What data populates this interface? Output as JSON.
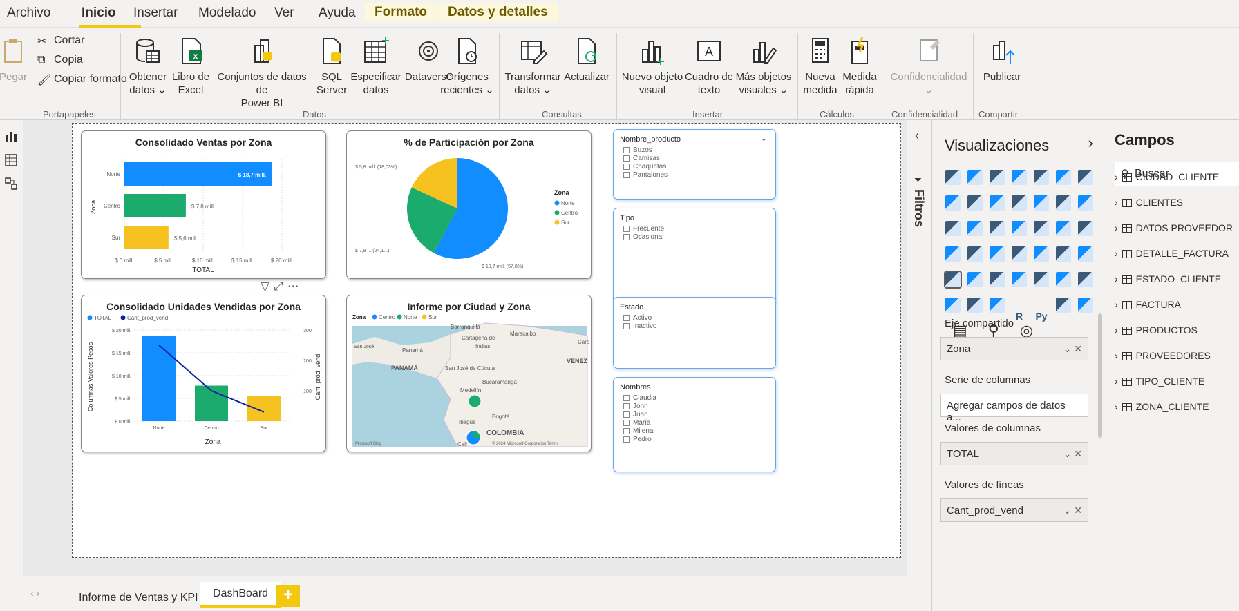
{
  "ribbon_tabs": {
    "archivo": "Archivo",
    "inicio": "Inicio",
    "insertar": "Insertar",
    "modelado": "Modelado",
    "ver": "Ver",
    "ayuda": "Ayuda",
    "formato": "Formato",
    "datos_detalles": "Datos y detalles"
  },
  "ribbon": {
    "pegar": "Pegar",
    "cortar": "Cortar",
    "copia": "Copia",
    "copiar_formato": "Copiar formato",
    "portapapeles": "Portapapeles",
    "obtener_datos": [
      "Obtener",
      "datos ⌄"
    ],
    "libro_excel": [
      "Libro de",
      "Excel"
    ],
    "conjuntos": [
      "Conjuntos de datos de",
      "Power BI"
    ],
    "sql": [
      "SQL",
      "Server"
    ],
    "especificar": [
      "Especificar",
      "datos"
    ],
    "dataverse": [
      "Dataverse",
      ""
    ],
    "origenes": [
      "Orígenes",
      "recientes ⌄"
    ],
    "datos_group": "Datos",
    "transformar": [
      "Transformar",
      "datos ⌄"
    ],
    "actualizar": [
      "Actualizar",
      ""
    ],
    "consultas_group": "Consultas",
    "nuevo_objeto": [
      "Nuevo objeto",
      "visual"
    ],
    "cuadro_texto": [
      "Cuadro de",
      "texto"
    ],
    "mas_objetos": [
      "Más objetos",
      "visuales ⌄"
    ],
    "insertar_group": "Insertar",
    "nueva_medida": [
      "Nueva",
      "medida"
    ],
    "medida_rapida": [
      "Medida",
      "rápida"
    ],
    "calculos_group": "Cálculos",
    "confidencialidad": "Confidencialidad",
    "confidencialidad_group": "Confidencialidad",
    "publicar": "Publicar",
    "compartir_group": "Compartir"
  },
  "colors": {
    "accent": "#f2c811",
    "norte": "#118dff",
    "centro": "#1aab6d",
    "sur": "#f5c220",
    "line": "#12239e"
  },
  "visual1": {
    "title": "Consolidado Ventas por Zona",
    "xlabel": "TOTAL",
    "ylabel": "Zona"
  },
  "visual2": {
    "title": "% de Participación por Zona",
    "legend_title": "Zona",
    "legend": [
      "Norte",
      "Centro",
      "Sur"
    ]
  },
  "visual3": {
    "title": "Consolidado Unidades Vendidas por Zona",
    "legend": [
      "TOTAL",
      "Cant_prod_vend"
    ],
    "xlabel": "Zona",
    "ylabel_left": "Columnas Valores Pesos",
    "ylabel_right": "Cant_prod_vend"
  },
  "visual4": {
    "title": "Informe por Ciudad y Zona",
    "legend_title": "Zona",
    "legend": [
      "Centro",
      "Norte",
      "Sur"
    ],
    "places": [
      "Barranquilla",
      "Maracaibo",
      "Cartagena de",
      "Indias",
      "San José",
      "Panamá",
      "PANAMÁ",
      "San José de Cúcuta",
      "VENEZ",
      "Bucaramanga",
      "Medellín",
      "Bogotá",
      "Ibagué",
      "COLOMBIA",
      "Cali",
      "Cara"
    ],
    "bing": "Microsoft Bing",
    "copyright": "© 2024 Microsoft Corporation  Terms"
  },
  "chart_data": [
    {
      "type": "bar",
      "title": "Consolidado Ventas por Zona",
      "orientation": "horizontal",
      "categories": [
        "Norte",
        "Centro",
        "Sur"
      ],
      "values": [
        18.7,
        7.8,
        5.6
      ],
      "data_labels": [
        "$ 18,7 mill.",
        "$ 7,8 mill.",
        "$ 5,6 mill."
      ],
      "xlabel": "TOTAL",
      "ylabel": "Zona",
      "xticks": [
        "$ 0 mill.",
        "$ 5 mill.",
        "$ 10 mill.",
        "$ 15 mill.",
        "$ 20 mill."
      ],
      "xlim": [
        0,
        20
      ]
    },
    {
      "type": "pie",
      "title": "% de Participación por Zona",
      "categories": [
        "Norte",
        "Centro",
        "Sur"
      ],
      "values": [
        57.8,
        24.1,
        18.1
      ],
      "data_labels": [
        "$ 18,7 mill. (57,8%)",
        "$ 7,8 ... (24,1...)",
        "$ 5,8 mill. (18,03%)"
      ]
    },
    {
      "type": "bar",
      "title": "Consolidado Unidades Vendidas por Zona",
      "categories": [
        "Norte",
        "Centro",
        "Sur"
      ],
      "series": [
        {
          "name": "TOTAL",
          "kind": "bar",
          "axis": "left",
          "values": [
            18.7,
            7.8,
            5.6
          ]
        },
        {
          "name": "Cant_prod_vend",
          "kind": "line",
          "axis": "right",
          "values": [
            250,
            100,
            30
          ]
        }
      ],
      "yticks_left": [
        "$ 0 mill.",
        "$ 5 mill.",
        "$ 10 mill.",
        "$ 15 mill.",
        "$ 20 mill."
      ],
      "ylim_left": [
        0,
        20
      ],
      "yticks_right": [
        "100",
        "200",
        "300"
      ],
      "ylim_right": [
        0,
        300
      ]
    }
  ],
  "slicers": [
    {
      "title": "Nombre_producto",
      "items": [
        "Buzos",
        "Camisas",
        "Chaquetas",
        "Pantalones"
      ]
    },
    {
      "title": "Tipo",
      "items": [
        "Frecuente",
        "Ocasional"
      ]
    },
    {
      "title": "Estado",
      "items": [
        "Activo",
        "Inactivo"
      ]
    },
    {
      "title": "Nombres",
      "items": [
        "Claudia",
        "John",
        "Juan",
        "María",
        "Milena",
        "Pedro"
      ]
    }
  ],
  "filters_label": "Filtros",
  "visualizations": {
    "title": "Visualizaciones",
    "eje_compartido": "Eje compartido",
    "eje_value": "Zona",
    "serie_columnas": "Serie de columnas",
    "serie_placeholder": "Agregar campos de datos a...",
    "valores_columnas": "Valores de columnas",
    "valores_columnas_value": "TOTAL",
    "valores_lineas": "Valores de líneas",
    "valores_lineas_value": "Cant_prod_vend",
    "icon_r": "R",
    "icon_py": "Py",
    "icon_more": "···"
  },
  "fields": {
    "title": "Campos",
    "search_placeholder": "Buscar",
    "tables": [
      "CIUDAD_CLIENTE",
      "CLIENTES",
      "DATOS PROVEEDOR",
      "DETALLE_FACTURA",
      "ESTADO_CLIENTE",
      "FACTURA",
      "PRODUCTOS",
      "PROVEEDORES",
      "TIPO_CLIENTE",
      "ZONA_CLIENTE"
    ]
  },
  "page_tabs": [
    "Informe de Ventas y KPI",
    "DashBoard"
  ],
  "add_tab": "+"
}
